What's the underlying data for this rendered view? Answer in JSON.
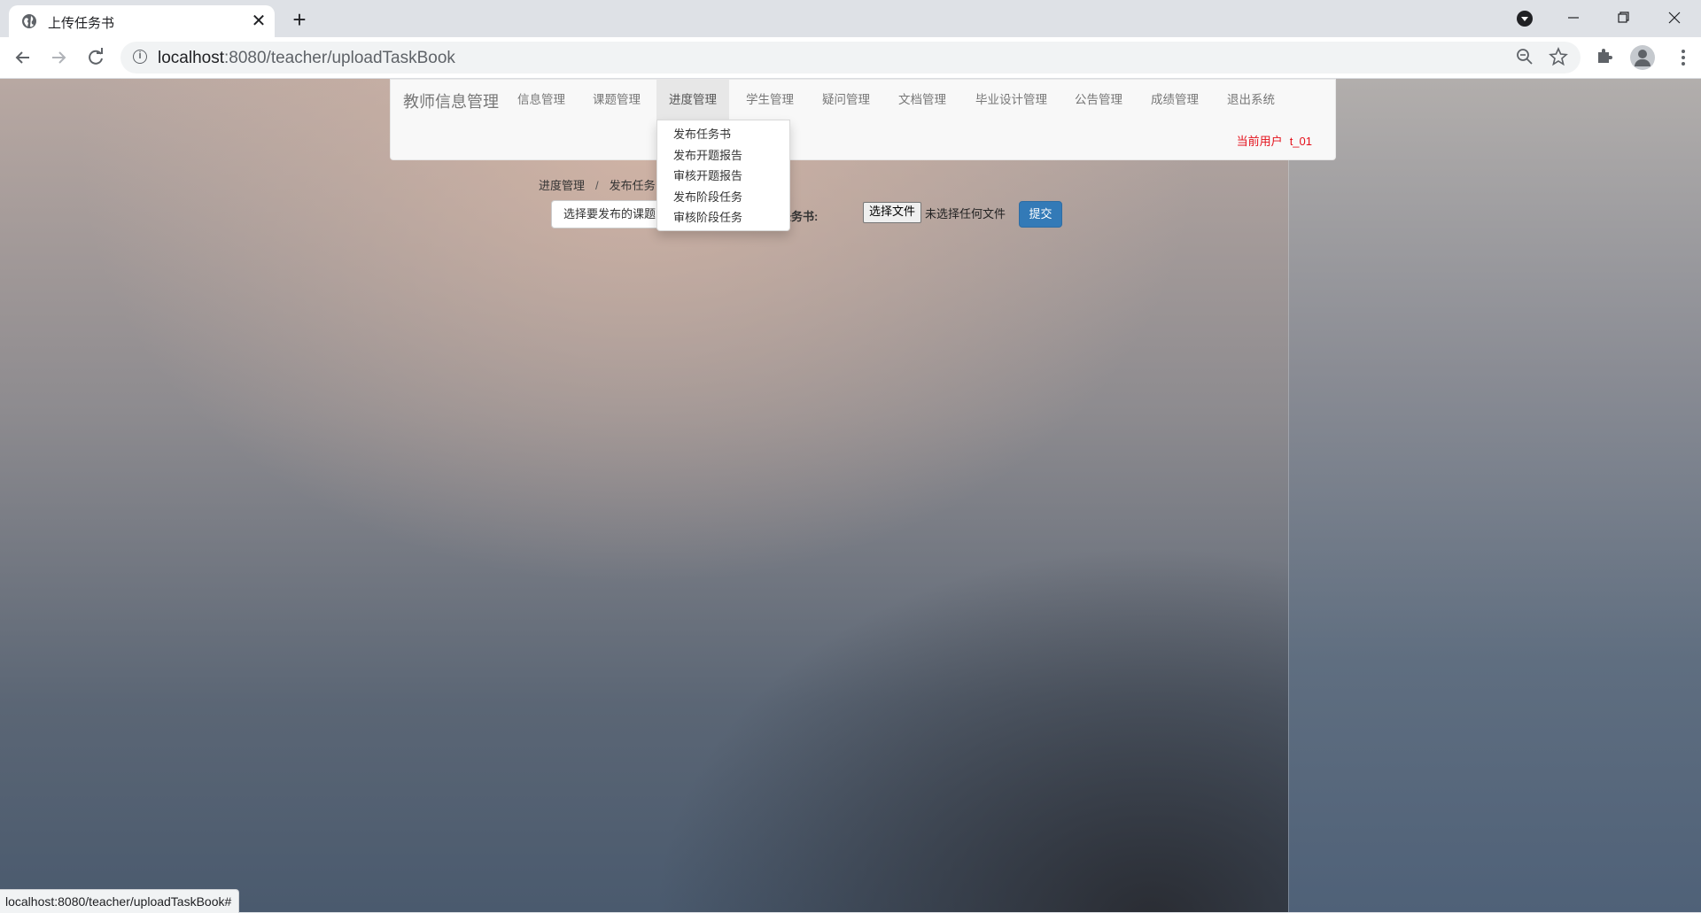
{
  "browser": {
    "tab_title": "上传任务书",
    "url_host": "localhost",
    "url_path": ":8080/teacher/uploadTaskBook",
    "status_url": "localhost:8080/teacher/uploadTaskBook#"
  },
  "navbar": {
    "brand": "教师信息管理",
    "items": [
      {
        "label": "信息管理"
      },
      {
        "label": "课题管理"
      },
      {
        "label": "进度管理"
      },
      {
        "label": "学生管理"
      },
      {
        "label": "疑问管理"
      },
      {
        "label": "文档管理"
      },
      {
        "label": "毕业设计管理"
      },
      {
        "label": "公告管理"
      },
      {
        "label": "成绩管理"
      },
      {
        "label": "退出系统"
      }
    ],
    "active_item": "进度管理",
    "current_user_label": "当前用户",
    "current_user_value": "t_01"
  },
  "dropdown": {
    "items": [
      {
        "label": "发布任务书"
      },
      {
        "label": "发布开题报告"
      },
      {
        "label": "审核开题报告"
      },
      {
        "label": "发布阶段任务"
      },
      {
        "label": "审核阶段任务"
      }
    ]
  },
  "content": {
    "breadcrumb_parent": "进度管理",
    "breadcrumb_separator": "/",
    "breadcrumb_current": "发布任务",
    "select_placeholder": "选择要发布的课题",
    "task_label": "任务书:",
    "file_button": "选择文件",
    "file_status": "未选择任何文件",
    "submit": "提交"
  },
  "colors": {
    "navbar_bg": "#f8f8f8",
    "current_user": "#e4111b",
    "submit_bg": "#337ab7"
  }
}
